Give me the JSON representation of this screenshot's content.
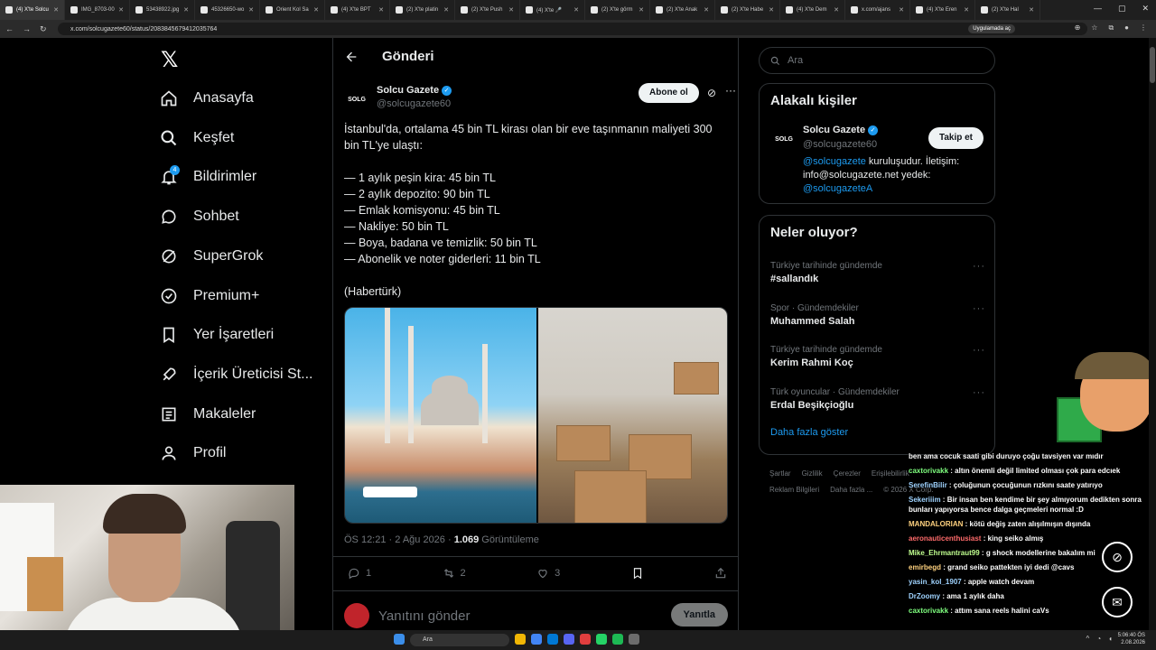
{
  "browser": {
    "tabs": [
      {
        "label": "(4) X'te Solcu"
      },
      {
        "label": "IMG_8703-00"
      },
      {
        "label": "53438922.jpg"
      },
      {
        "label": "45326650-wo"
      },
      {
        "label": "Orient Kol Sa"
      },
      {
        "label": "(4) X'te BPT"
      },
      {
        "label": "(2) X'te platin"
      },
      {
        "label": "(2) X'te Push"
      },
      {
        "label": "(4) X'te 🎤"
      },
      {
        "label": "(2) X'te görm"
      },
      {
        "label": "(2) X'te Anak"
      },
      {
        "label": "(2) X'te Habe"
      },
      {
        "label": "(4) X'te Dem"
      },
      {
        "label": "x.com/ajans"
      },
      {
        "label": "(4) X'te Eren"
      },
      {
        "label": "(2) X'te Hal"
      }
    ],
    "url": "x.com/solcugazete60/status/2083845679412035764",
    "app_pill": "Uygulamada aç"
  },
  "nav": {
    "logo": "𝕏",
    "items": [
      {
        "label": "Anasayfa",
        "icon": "home-icon"
      },
      {
        "label": "Keşfet",
        "icon": "search-icon"
      },
      {
        "label": "Bildirimler",
        "icon": "bell-icon",
        "badge": "4"
      },
      {
        "label": "Sohbet",
        "icon": "chat-icon"
      },
      {
        "label": "SuperGrok",
        "icon": "grok-icon"
      },
      {
        "label": "Premium+",
        "icon": "premium-icon"
      },
      {
        "label": "Yer İşaretleri",
        "icon": "bookmark-icon"
      },
      {
        "label": "İçerik Üreticisi St...",
        "icon": "rocket-icon"
      },
      {
        "label": "Makaleler",
        "icon": "article-icon"
      },
      {
        "label": "Profil",
        "icon": "profile-icon"
      }
    ]
  },
  "post": {
    "header_title": "Gönderi",
    "author_avatar_text": "SOLG",
    "author_name": "Solcu Gazete",
    "author_handle": "@solcugazete60",
    "subscribe_label": "Abone ol",
    "lines": [
      "İstanbul'da, ortalama 45 bin TL kirası olan bir eve taşınmanın maliyeti 300 bin TL'ye ulaştı:",
      "",
      "— 1 aylık peşin kira: 45 bin TL",
      "— 2 aylık depozito: 90 bin TL",
      "— Emlak komisyonu: 45 bin TL",
      "— Nakliye: 50 bin TL",
      "— Boya, badana ve temizlik: 50 bin TL",
      "— Abonelik ve noter giderleri: 11 bin TL",
      "",
      "(Habertürk)"
    ],
    "time": "ÖS 12:21 · 2 Ağu 2026 · ",
    "views_count": "1.069",
    "views_label": " Görüntüleme",
    "replies": "1",
    "reposts": "2",
    "likes": "3",
    "reply_placeholder": "Yanıtını gönder",
    "reply_button": "Yanıtla"
  },
  "right": {
    "search_placeholder": "Ara",
    "related_title": "Alakalı kişiler",
    "related": {
      "avatar_text": "SOLG",
      "name": "Solcu Gazete",
      "handle": "@solcugazete60",
      "follow_label": "Takip et",
      "bio_link1": "@solcugazete",
      "bio_text": " kuruluşudur. İletişim: info@solcugazete.net yedek: ",
      "bio_link2": "@solcugazeteA"
    },
    "trends_title": "Neler oluyor?",
    "trends": [
      {
        "context": "Türkiye tarihinde gündemde",
        "title": "#sallandık"
      },
      {
        "context": "Spor · Gündemdekiler",
        "title": "Muhammed Salah"
      },
      {
        "context": "Türkiye tarihinde gündemde",
        "title": "Kerim Rahmi Koç"
      },
      {
        "context": "Türk oyuncular · Gündemdekiler",
        "title": "Erdal Beşikçioğlu"
      }
    ],
    "show_more": "Daha fazla göster",
    "footer": [
      "Şartlar",
      "Gizlilik",
      "Çerezler",
      "Erişilebilirlik",
      "Reklam Bilgileri",
      "Daha fazla ...",
      "© 2026 X Corp."
    ]
  },
  "chat": [
    {
      "user": "",
      "text": "ben ama cocuk saati gibi duruyo çoğu tavsiyen var mıdır",
      "cls": ""
    },
    {
      "user": "caxtorivakk",
      "text": " : altın önemli değil limited olması çok para edcıek",
      "cls": "u1"
    },
    {
      "user": "SerefinBilir",
      "text": " : çoluğunun çocuğunun rızkını saate yatırıyo",
      "cls": "u2"
    },
    {
      "user": "Sekeriiim",
      "text": " : Bir insan ben kendime bir şey almıyorum dedikten sonra bunları yapıyorsa bence dalga geçmeleri normal :D",
      "cls": "u2"
    },
    {
      "user": "MANDALORIAN",
      "text": " : kötü değiş zaten alışılmışın dışında",
      "cls": "u3"
    },
    {
      "user": "aeronauticenthusiast",
      "text": " : king seiko almış",
      "cls": "u4"
    },
    {
      "user": "Mike_Ehrmantraut99",
      "text": " : g shock modellerine bakalım mi",
      "cls": "u5"
    },
    {
      "user": "emirbegd",
      "text": " : grand seiko pattekten iyi dedi @cavs",
      "cls": "u3"
    },
    {
      "user": "yasin_kol_1907",
      "text": " : apple watch devam",
      "cls": "u2"
    },
    {
      "user": "DrZoomy",
      "text": " : ama 1 aylık daha",
      "cls": "u2"
    },
    {
      "user": "caxtorivakk",
      "text": " : attım sana reels halini caVs",
      "cls": "u1"
    }
  ],
  "taskbar": {
    "search_placeholder": "Ara",
    "time": "5:06:40 ÖS",
    "date": "2.08.2026"
  },
  "colors": {
    "accent": "#1d9bf0",
    "background": "#000000",
    "border": "#2f3336"
  }
}
